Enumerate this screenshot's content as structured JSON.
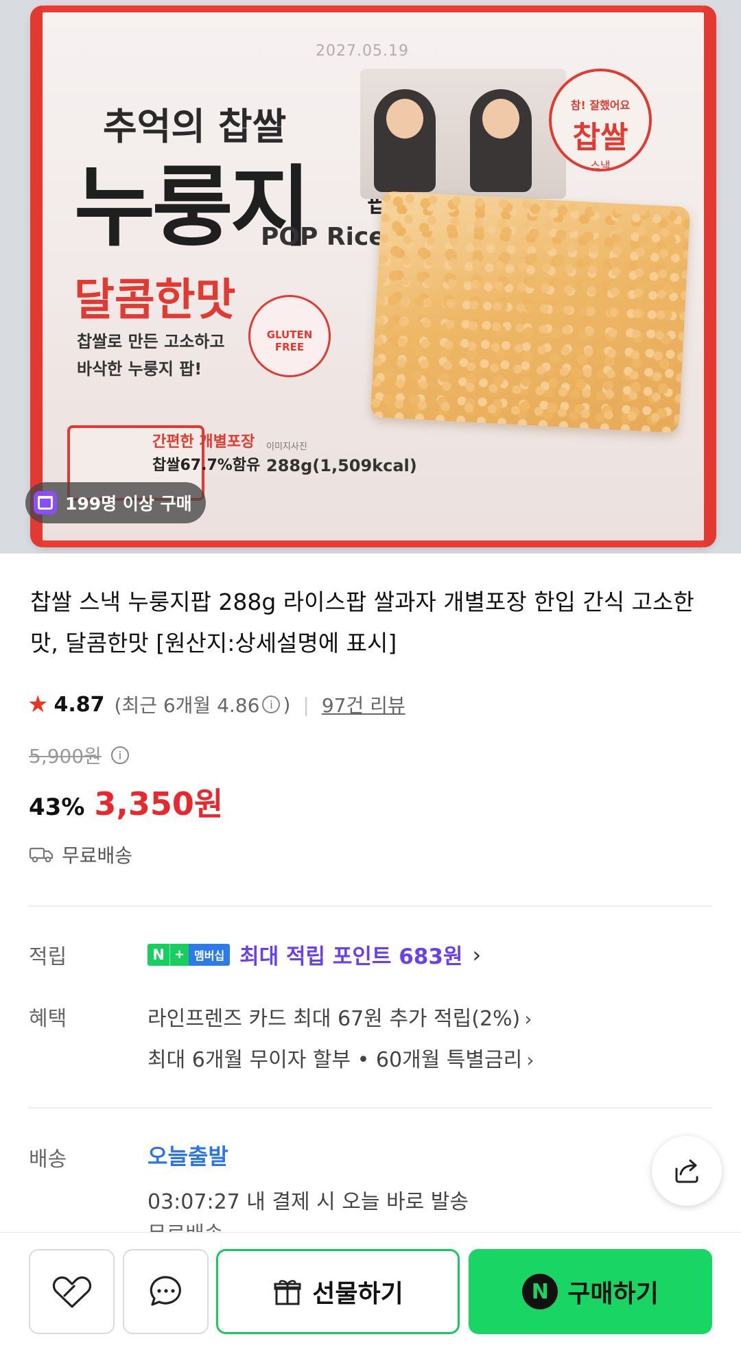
{
  "hero": {
    "pack_date": "2027.05.19",
    "pack_sub_title": "추억의 찹쌀",
    "pack_main_title": "누룽지",
    "pack_main_suffix": "팝",
    "pack_english": "POP Rice",
    "pack_flavor": "달콤한맛",
    "pack_desc_1": "찹쌀로 만든 고소하고",
    "pack_desc_2": "바삭한 누룽지 팝!",
    "pack_badge_top": "참! 잘했어요",
    "pack_badge_main": "찹쌀",
    "pack_badge_bottom": "스낵",
    "pack_gluten": "GLUTEN FREE",
    "pack_individual": "간편한 개별포장",
    "pack_rice_pct": "찹쌀67.7%함유",
    "pack_image_note": "이미지사진",
    "pack_weight": "288g(1,509kcal)",
    "purchase_badge": "199명 이상 구매"
  },
  "product": {
    "title": "찹쌀 스낵 누룽지팝 288g 라이스팝 쌀과자 개별포장 한입 간식 고소한맛, 달콤한맛 [원산지:상세설명에 표시]",
    "rating": "4.87",
    "recent_prefix": "(최근 6개월 4.86",
    "recent_suffix": ")",
    "review_link": "97건 리뷰",
    "original_price": "5,900원",
    "discount": "43%",
    "sale_price": "3,350원",
    "shipping": "무료배송"
  },
  "points": {
    "label": "적립",
    "badge_n": "N",
    "badge_plus": "+",
    "badge_membership": "멤버십",
    "text": "최대 적립 포인트 683원"
  },
  "benefits": {
    "label": "혜택",
    "line1": "라인프렌즈 카드 최대 67원 추가 적립(2%)",
    "line2": "최대 6개월 무이자 할부 • 60개월 특별금리"
  },
  "delivery": {
    "label": "배송",
    "title": "오늘출발",
    "line": "03:07:27  내 결제 시 오늘 바로 발송",
    "partial": "무료배송"
  },
  "bottom_bar": {
    "gift_label": "선물하기",
    "buy_label": "구매하기",
    "buy_badge": "N"
  },
  "colors": {
    "sale_red": "#e8282d",
    "point_purple": "#6a3ff0",
    "delivery_blue": "#2a76e8",
    "naver_green": "#19d664"
  }
}
